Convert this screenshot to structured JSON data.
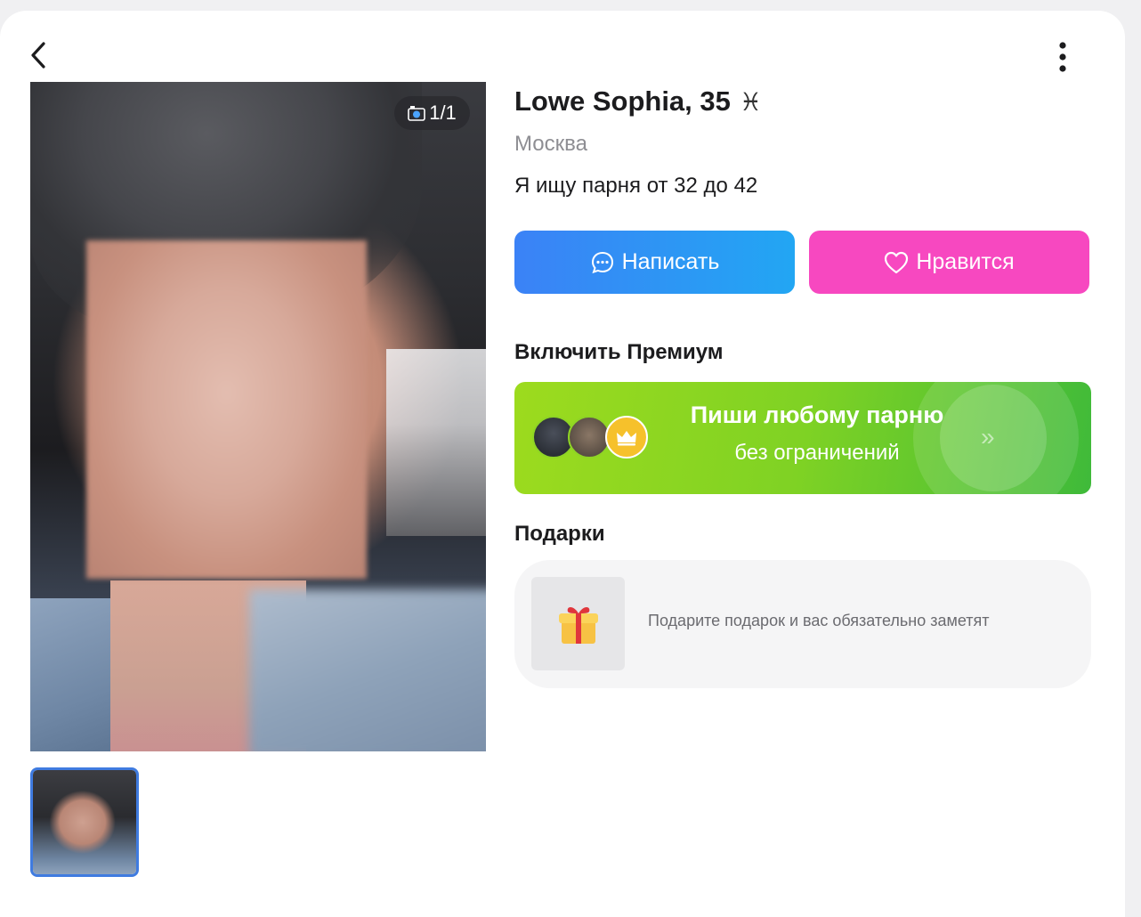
{
  "profile": {
    "name_age": "Lowe Sophia, 35",
    "zodiac_symbol": "♓",
    "city": "Москва",
    "looking_for": "Я ищу парня от 32 до 42",
    "photo_counter": "1/1"
  },
  "actions": {
    "write_label": "Написать",
    "like_label": "Нравится"
  },
  "premium": {
    "section_title": "Включить Премиум",
    "title": "Пиши любому парню",
    "subtitle": "без ограничений",
    "arrow": "»"
  },
  "gifts": {
    "section_title": "Подарки",
    "text": "Подарите подарок и вас обязательно заметят"
  },
  "icons": {
    "back": "chevron-left-icon",
    "menu": "more-vertical-icon",
    "camera": "camera-icon",
    "chat": "chat-bubble-icon",
    "heart": "heart-icon",
    "crown": "crown-icon",
    "gift": "gift-icon"
  },
  "colors": {
    "write_button": "#3b82f6",
    "like_button": "#f748c0",
    "premium_banner": "#7fd224",
    "thumbnail_border": "#3f7be0"
  }
}
